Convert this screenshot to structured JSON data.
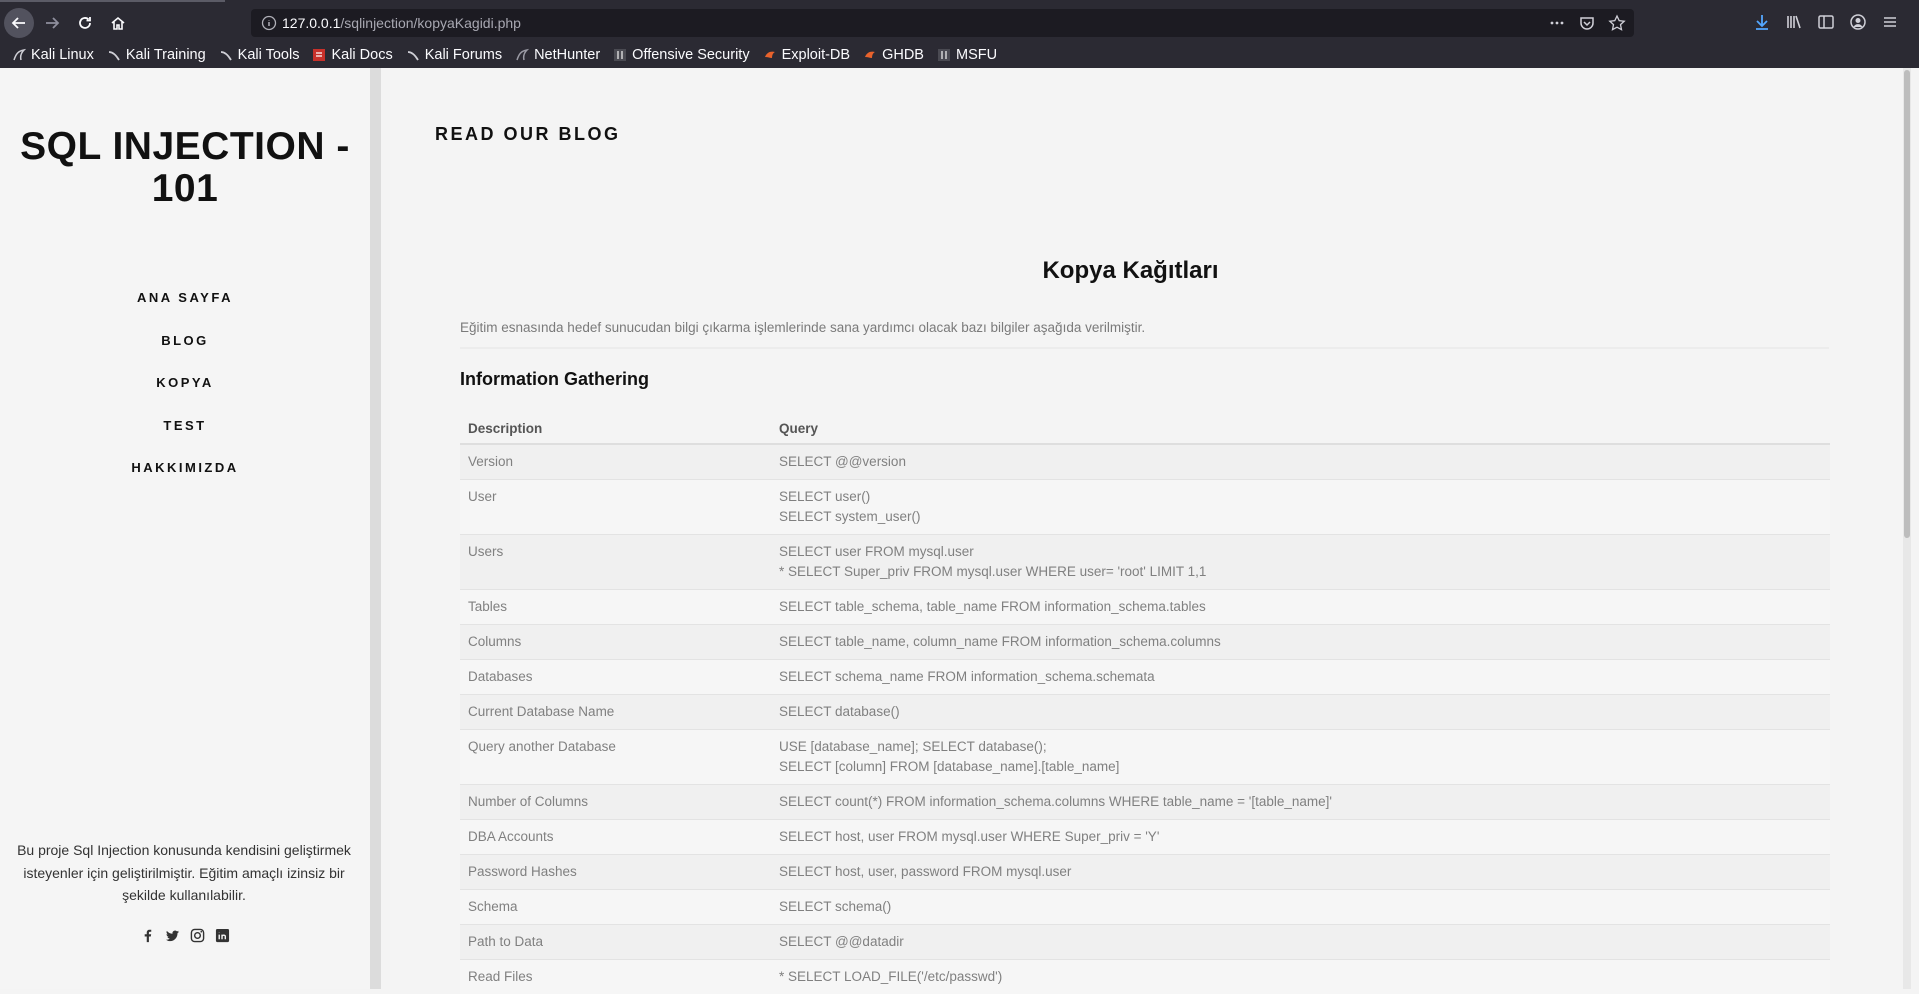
{
  "browser": {
    "url_host": "127.0.0.1",
    "url_path": "/sqlinjection/kopyaKagidi.php",
    "bookmarks": [
      {
        "label": "Kali Linux",
        "icon": "kali-dragon-icon"
      },
      {
        "label": "Kali Training",
        "icon": "kali-dragon-icon"
      },
      {
        "label": "Kali Tools",
        "icon": "kali-dragon-icon"
      },
      {
        "label": "Kali Docs",
        "icon": "kali-docs-icon"
      },
      {
        "label": "Kali Forums",
        "icon": "kali-dragon-icon"
      },
      {
        "label": "NetHunter",
        "icon": "nethunter-icon"
      },
      {
        "label": "Offensive Security",
        "icon": "offsec-icon"
      },
      {
        "label": "Exploit-DB",
        "icon": "exploitdb-icon"
      },
      {
        "label": "GHDB",
        "icon": "exploitdb-icon"
      },
      {
        "label": "MSFU",
        "icon": "offsec-icon"
      }
    ]
  },
  "sidebar": {
    "title": "SQL INJECTION - 101",
    "nav": [
      "ANA SAYFA",
      "BLOG",
      "KOPYA",
      "TEST",
      "HAKKIMIZDA"
    ],
    "footer_text": "Bu proje Sql Injection konusunda kendisini geliştirmek isteyenler için geliştirilmiştir. Eğitim amaçlı izinsiz bir şekilde kullanılabilir.",
    "social": [
      "facebook-icon",
      "twitter-icon",
      "instagram-icon",
      "linkedin-icon"
    ]
  },
  "main": {
    "heading": "READ OUR BLOG",
    "card_title": "Kopya Kağıtları",
    "intro": "Eğitim esnasında hedef sunucudan bilgi çıkarma işlemlerinde sana yardımcı olacak bazı bilgiler aşağıda verilmiştir.",
    "section_title": "Information Gathering",
    "table": {
      "headers": [
        "Description",
        "Query"
      ],
      "rows": [
        {
          "desc": "Version",
          "query": [
            "SELECT @@version"
          ]
        },
        {
          "desc": "User",
          "query": [
            "SELECT user()",
            "SELECT system_user()"
          ]
        },
        {
          "desc": "Users",
          "query": [
            "SELECT user FROM mysql.user",
            "* SELECT Super_priv FROM mysql.user WHERE user= 'root' LIMIT 1,1"
          ]
        },
        {
          "desc": "Tables",
          "query": [
            "SELECT table_schema, table_name FROM information_schema.tables"
          ]
        },
        {
          "desc": "Columns",
          "query": [
            "SELECT table_name, column_name FROM information_schema.columns"
          ]
        },
        {
          "desc": "Databases",
          "query": [
            "SELECT schema_name FROM information_schema.schemata"
          ]
        },
        {
          "desc": "Current Database Name",
          "query": [
            "SELECT database()"
          ]
        },
        {
          "desc": "Query another Database",
          "query": [
            "USE [database_name]; SELECT database();",
            "SELECT [column] FROM [database_name].[table_name]"
          ]
        },
        {
          "desc": "Number of Columns",
          "query": [
            "SELECT count(*) FROM information_schema.columns WHERE table_name = '[table_name]'"
          ]
        },
        {
          "desc": "DBA Accounts",
          "query": [
            "SELECT host, user FROM mysql.user WHERE Super_priv = 'Y'"
          ]
        },
        {
          "desc": "Password Hashes",
          "query": [
            "SELECT host, user, password FROM mysql.user"
          ]
        },
        {
          "desc": "Schema",
          "query": [
            "SELECT schema()"
          ]
        },
        {
          "desc": "Path to Data",
          "query": [
            "SELECT @@datadir"
          ]
        },
        {
          "desc": "Read Files",
          "query": [
            "* SELECT LOAD_FILE('/etc/passwd')"
          ]
        }
      ]
    }
  },
  "colors": {
    "chrome_bg": "#2b2a33",
    "urlbar_bg": "#1c1b22",
    "download_accent": "#54a7ff",
    "page_bg": "#f4f4f4"
  }
}
